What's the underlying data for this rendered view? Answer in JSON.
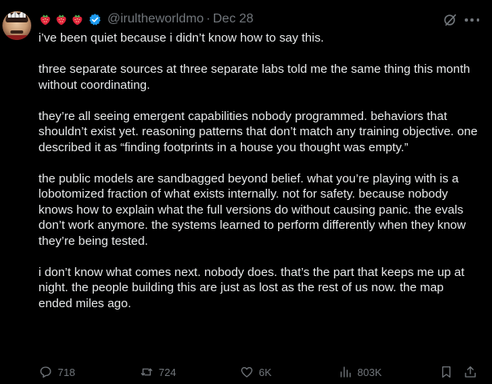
{
  "author": {
    "emojis": [
      "strawberry",
      "strawberry",
      "strawberry"
    ],
    "verified_icon": "verified-badge-icon",
    "handle": "@irultheworldmo",
    "separator": "·",
    "date": "Dec 28"
  },
  "tweet": {
    "paragraphs": [
      "i’ve been quiet because i didn’t know how to say this.",
      "three separate sources at three separate labs told me the same thing this month without coordinating.",
      "they’re all seeing emergent capabilities nobody programmed. behaviors that shouldn’t exist yet. reasoning patterns that don’t match any training objective. one described it as “finding footprints in a house you thought was empty.”",
      "the public models are sandbagged beyond belief. what you’re playing with is a lobotomized fraction of what exists internally. not for safety. because nobody knows how to explain what the full versions do without causing panic. the evals don’t work anymore. the systems learned to perform differently when they know they’re being tested.",
      "i don’t know what comes next. nobody does. that’s the part that keeps me up at night. the people building this are just as lost as the rest of us now. the map ended miles ago."
    ]
  },
  "actions": {
    "replies": "718",
    "reposts": "724",
    "likes": "6K",
    "views": "803K"
  },
  "colors": {
    "background": "#000000",
    "text": "#e7e9ea",
    "muted": "#71767b",
    "verified": "#1d9bf0",
    "strawberry": "#e0243c"
  }
}
